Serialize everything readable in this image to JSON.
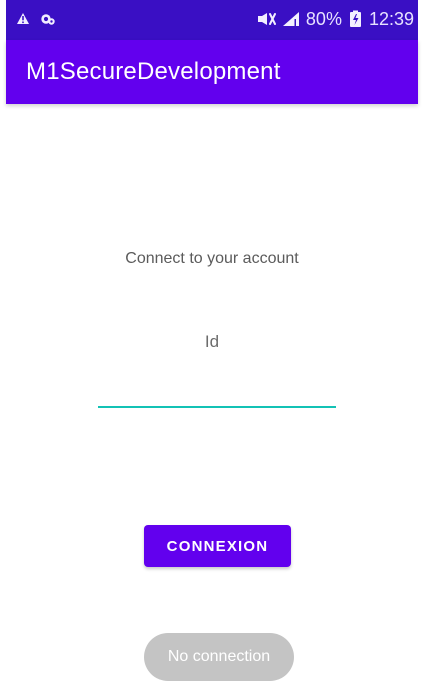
{
  "status_bar": {
    "battery_percent": "80%",
    "time": "12:39",
    "icons": [
      "warning-icon",
      "notification-icon",
      "mute-icon",
      "signal-icon",
      "battery-icon"
    ]
  },
  "app_bar": {
    "title": "M1SecureDevelopment"
  },
  "login_form": {
    "instruction": "Connect to your account",
    "id_label": "Id",
    "id_value": "",
    "connect_button_label": "CONNEXION"
  },
  "toast": {
    "message": "No connection"
  },
  "colors": {
    "status_bar": "#3a0fc4",
    "app_bar": "#6200ee",
    "button": "#6200ee",
    "input_underline": "#13c2b5",
    "toast_background": "#c4c4c4"
  }
}
